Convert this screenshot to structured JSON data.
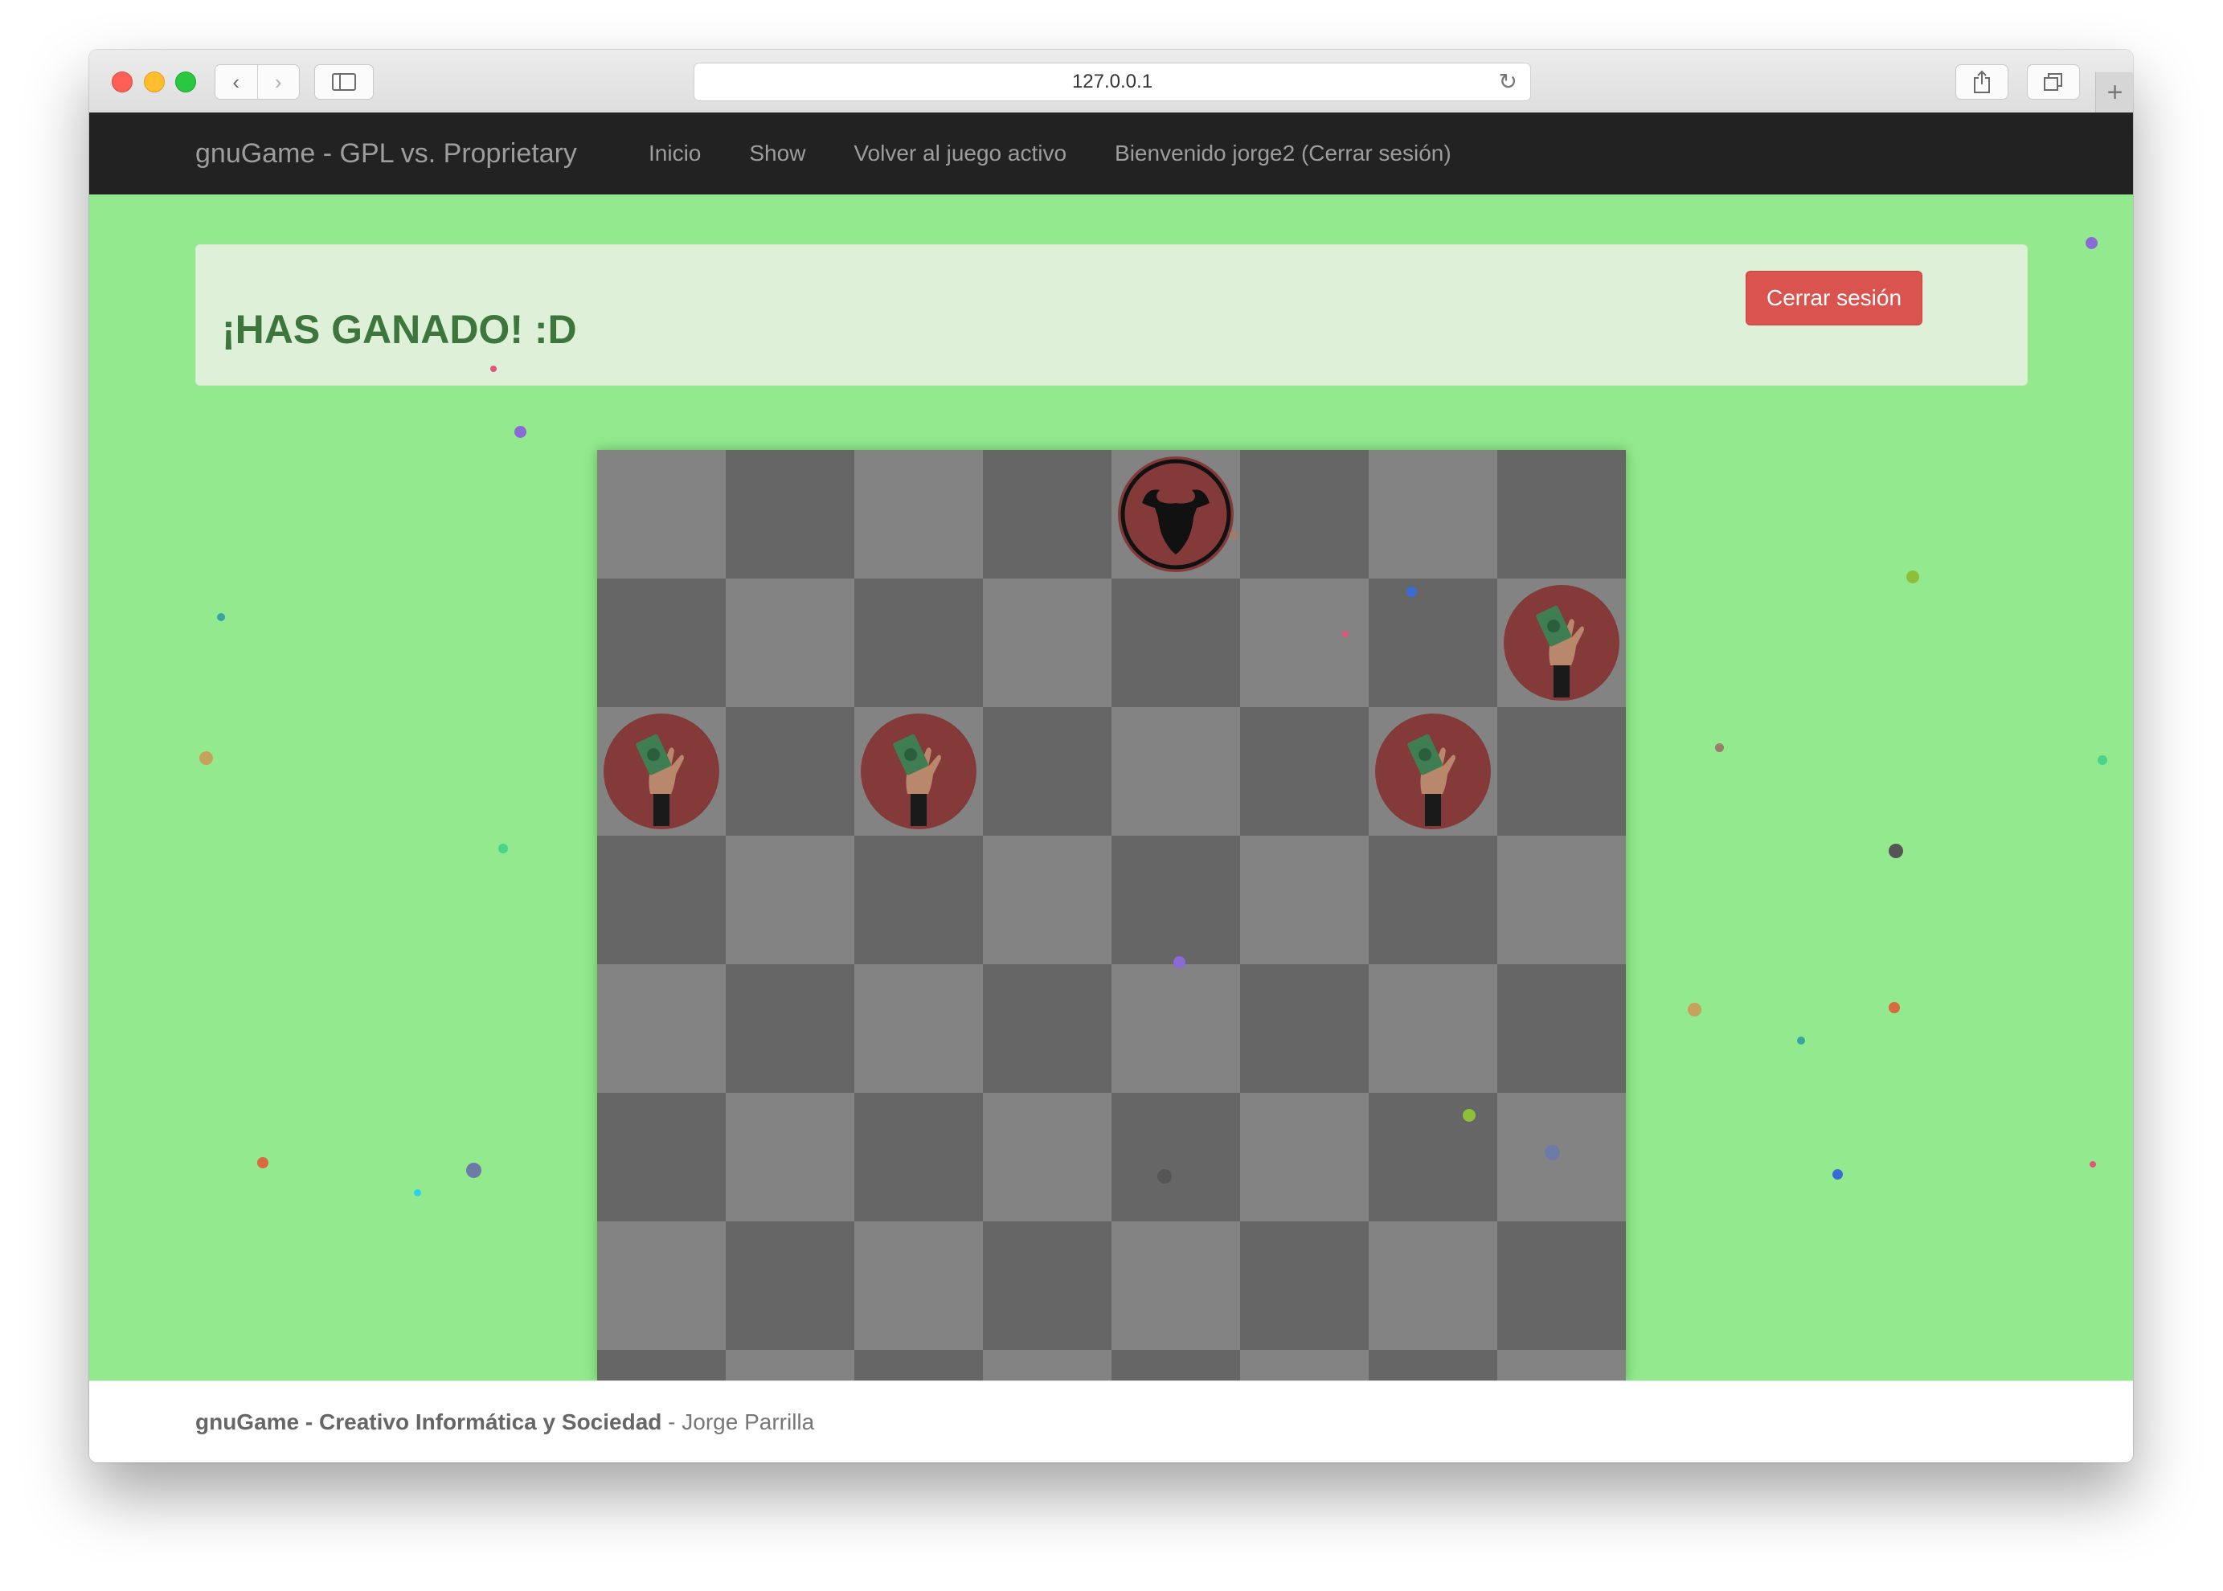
{
  "browser": {
    "url": "127.0.0.1"
  },
  "navbar": {
    "brand": "gnuGame - GPL vs. Proprietary",
    "links": [
      {
        "label": "Inicio"
      },
      {
        "label": "Show"
      },
      {
        "label": "Volver al juego activo"
      },
      {
        "label": "Bienvenido jorge2 (Cerrar sesión)"
      }
    ]
  },
  "alert": {
    "title": "¡HAS GANADO! :D",
    "logout_label": "Cerrar sesión"
  },
  "board": {
    "rows_visible": 8,
    "cols": 8,
    "pieces": [
      {
        "type": "gnu",
        "row": 0,
        "col": 4
      },
      {
        "type": "money-hand",
        "row": 1,
        "col": 7
      },
      {
        "type": "money-hand",
        "row": 2,
        "col": 0
      },
      {
        "type": "money-hand",
        "row": 2,
        "col": 2
      },
      {
        "type": "money-hand",
        "row": 2,
        "col": 6
      }
    ]
  },
  "footer": {
    "bold_text": "gnuGame - Creativo Informática y Sociedad",
    "author_text": " - Jorge Parrilla"
  },
  "colors": {
    "background": "#93ea8e",
    "navbar": "#222222",
    "alert_bg": "#dff0d8",
    "alert_text": "#3c763d",
    "danger": "#d9534f",
    "light_square": "#838383",
    "dark_square": "#666666",
    "piece": "#853a3a"
  }
}
